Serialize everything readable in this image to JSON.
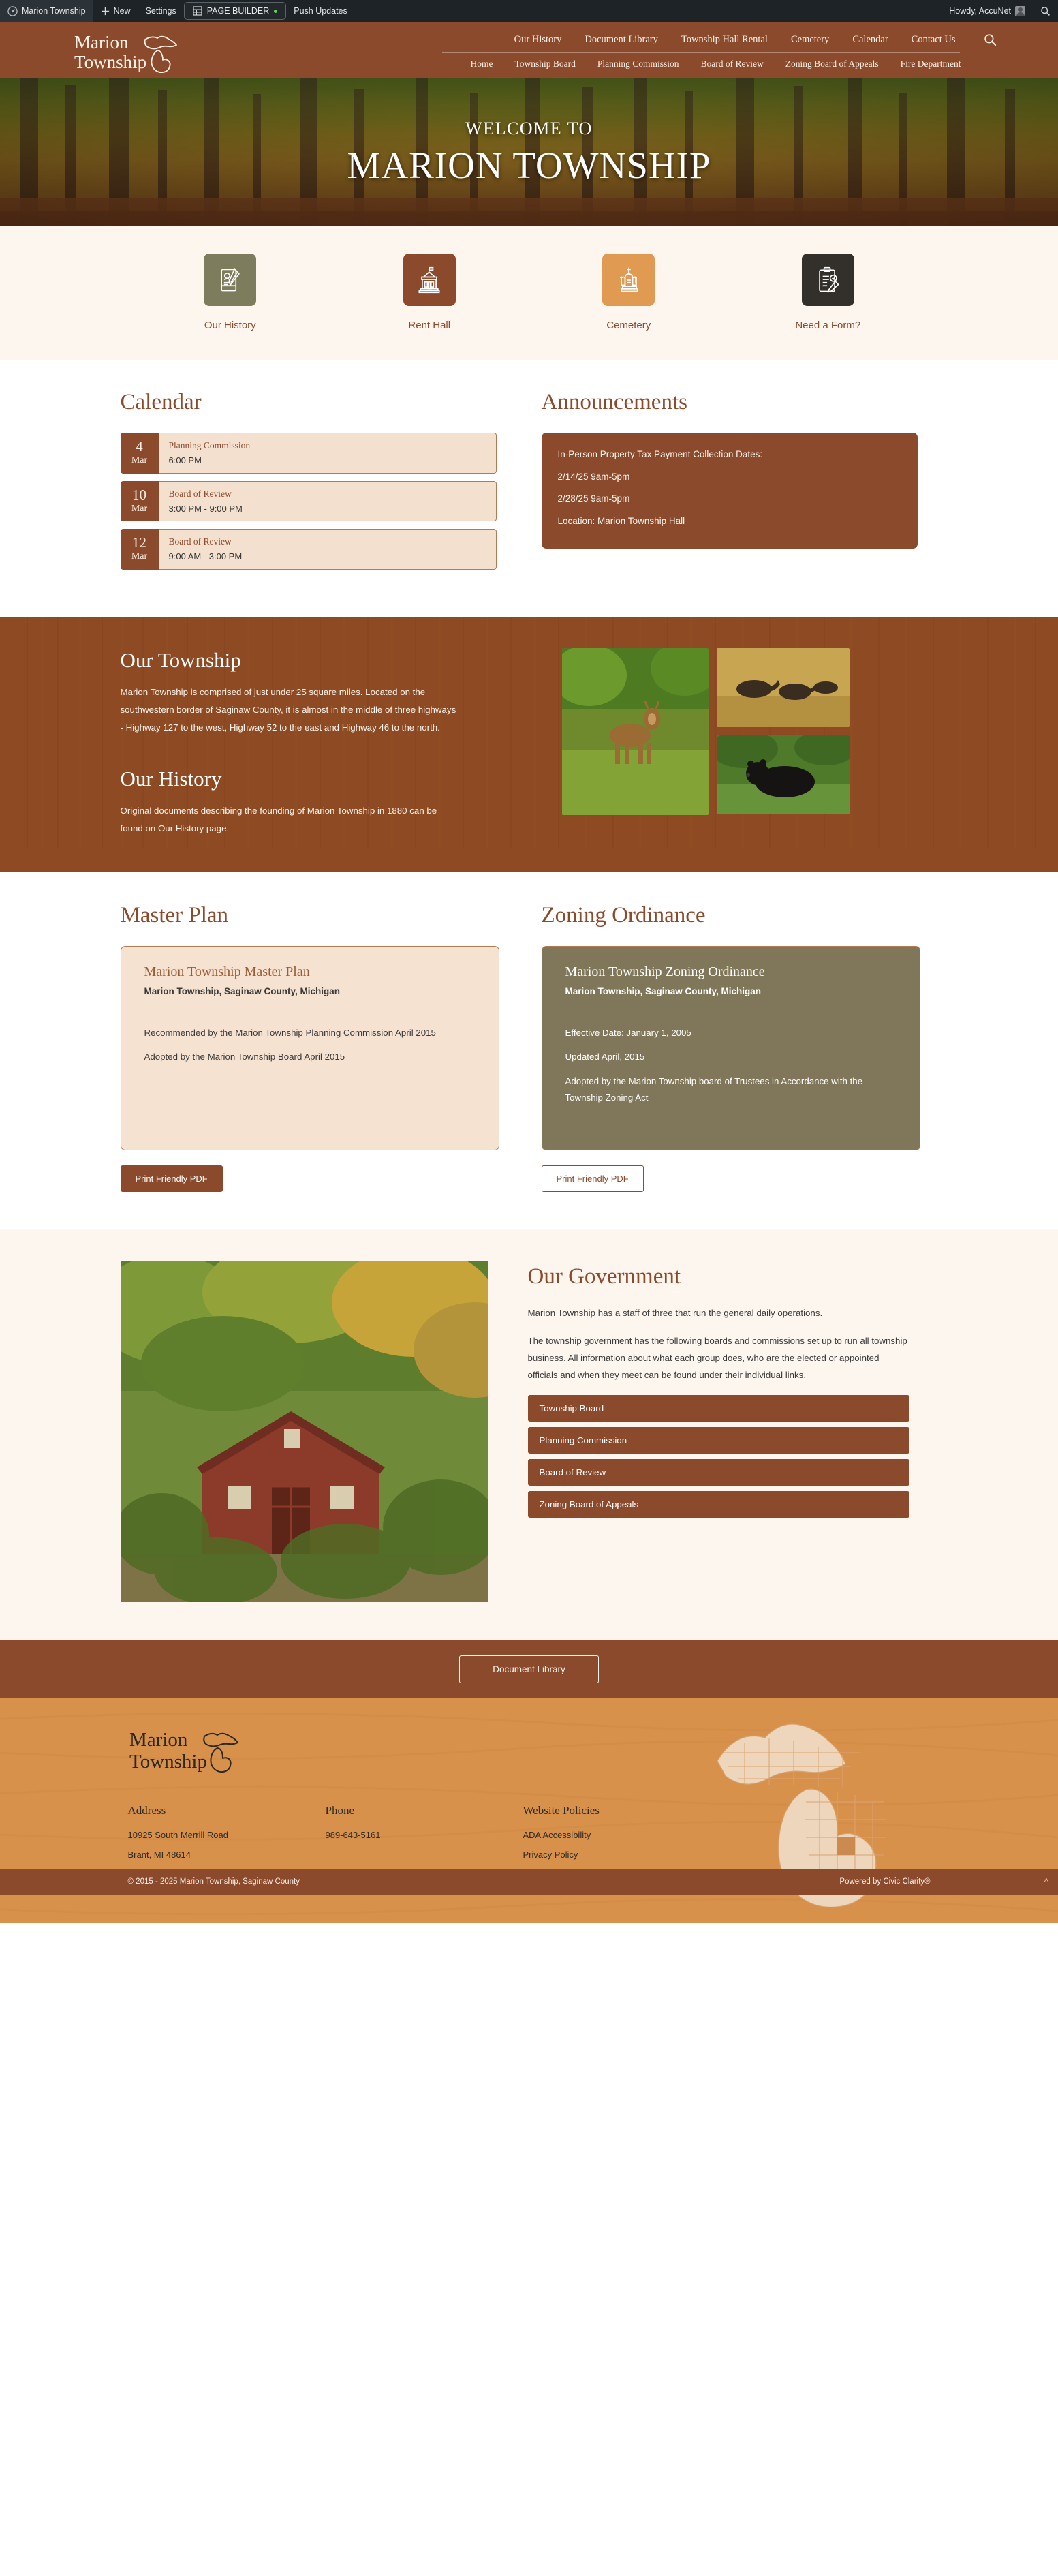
{
  "adminbar": {
    "site_name": "Marion Township",
    "new_label": "New",
    "settings_label": "Settings",
    "page_builder_label": "PAGE BUILDER",
    "push_updates_label": "Push Updates",
    "howdy_label": "Howdy, AccuNet",
    "search_icon": "search-icon",
    "dashboard_icon": "dashboard-icon",
    "plus_icon": "plus-icon",
    "builder_icon": "grid-icon"
  },
  "header": {
    "logo_line1": "Marion",
    "logo_line2": "Township",
    "logo_icon": "michigan-outline-icon",
    "search_icon": "search-icon",
    "primary_nav": [
      "Our History",
      "Document Library",
      "Township Hall Rental",
      "Cemetery",
      "Calendar",
      "Contact Us"
    ],
    "secondary_nav": [
      "Home",
      "Township Board",
      "Planning Commission",
      "Board of Review",
      "Zoning Board of Appeals",
      "Fire Department"
    ]
  },
  "hero": {
    "kicker": "WELCOME TO",
    "title": "MARION TOWNSHIP"
  },
  "quick_links": {
    "items": [
      {
        "label": "Our History",
        "icon": "document-quill-icon",
        "color": "#7d7d5e"
      },
      {
        "label": "Rent Hall",
        "icon": "town-hall-icon",
        "color": "#8b4a2b"
      },
      {
        "label": "Cemetery",
        "icon": "gravestone-icon",
        "color": "#e09a52"
      },
      {
        "label": "Need a Form?",
        "icon": "clipboard-pencil-icon",
        "color": "#33302b"
      }
    ]
  },
  "calendar": {
    "title": "Calendar",
    "events": [
      {
        "day": "4",
        "month": "Mar",
        "name": "Planning Commission",
        "time": "6:00 PM"
      },
      {
        "day": "10",
        "month": "Mar",
        "name": "Board of Review",
        "time": "3:00 PM - 9:00 PM"
      },
      {
        "day": "12",
        "month": "Mar",
        "name": "Board of Review",
        "time": "9:00 AM - 3:00 PM"
      }
    ]
  },
  "announcements": {
    "title": "Announcements",
    "lines": [
      "In-Person Property Tax Payment Collection Dates:",
      "2/14/25 9am-5pm",
      "2/28/25 9am-5pm",
      "Location: Marion Township Hall"
    ]
  },
  "township": {
    "heading": "Our Township",
    "body": "Marion Township is comprised of just under 25 square miles. Located on the southwestern border of Saginaw County, it is almost in the middle of three highways - Highway 127 to the west, Highway 52 to the east and Highway 46 to the north.",
    "history_heading": "Our History",
    "history_body": "Original documents describing the founding of Marion Township in 1880 can be found on Our History page.",
    "photos": [
      {
        "name": "deer-in-field-photo"
      },
      {
        "name": "wild-turkeys-photo"
      },
      {
        "name": "black-bear-photo"
      }
    ]
  },
  "master_plan": {
    "title": "Master Plan",
    "card_title": "Marion Township Master Plan",
    "card_sub": "Marion Township, Saginaw County, Michigan",
    "lines": [
      "Recommended by the Marion Township Planning Commission April 2015",
      "Adopted by the Marion Township Board April 2015"
    ],
    "button": "Print Friendly PDF"
  },
  "zoning": {
    "title": "Zoning Ordinance",
    "card_title": "Marion Township Zoning Ordinance",
    "card_sub": "Marion Township, Saginaw County, Michigan",
    "lines": [
      "Effective Date: January 1, 2005",
      "Updated April, 2015",
      "Adopted by the Marion Township board of Trustees in Accordance with the Township Zoning Act"
    ],
    "button": "Print Friendly PDF"
  },
  "government": {
    "title": "Our Government",
    "photo_name": "red-barn-autumn-photo",
    "paragraphs": [
      "Marion Township has a staff of three that run the general daily operations.",
      "The township government has the following boards and commissions set up to run all township business. All information about what each group does, who are the elected or appointed officials and when they meet can be found under their individual links."
    ],
    "links": [
      "Township Board",
      "Planning Commission",
      "Board of Review",
      "Zoning Board of Appeals"
    ]
  },
  "doc_bar": {
    "button": "Document Library"
  },
  "footer": {
    "logo_line1": "Marion",
    "logo_line2": "Township",
    "logo_icon": "michigan-outline-icon",
    "map_icon": "michigan-counties-map-icon",
    "columns": [
      {
        "heading": "Address",
        "items": [
          "10925 South Merrill Road",
          "Brant, MI 48614"
        ]
      },
      {
        "heading": "Phone",
        "items": [
          "989-643-5161"
        ]
      },
      {
        "heading": "Website Policies",
        "items": [
          "ADA Accessibility",
          "Privacy Policy"
        ]
      }
    ],
    "copyright": "© 2015 - 2025 Marion Township, Saginaw County",
    "powered_by": "Powered by Civic Clarity®",
    "to_top_icon": "chevron-up-icon"
  }
}
